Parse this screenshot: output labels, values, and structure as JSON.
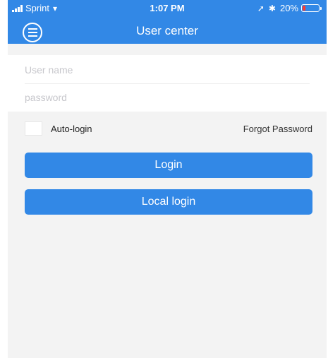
{
  "status_bar": {
    "carrier": "Sprint",
    "time": "1:07 PM",
    "battery": "20%",
    "battery_level": 0.2,
    "icons": [
      "signal-icon",
      "wifi-icon",
      "location-icon",
      "bluetooth-icon",
      "battery-icon"
    ]
  },
  "header": {
    "title": "User center",
    "menu_icon": "menu-icon"
  },
  "form": {
    "username_placeholder": "User name",
    "username_value": "",
    "password_placeholder": "password",
    "password_value": ""
  },
  "options": {
    "auto_login_label": "Auto-login",
    "auto_login_checked": false,
    "forgot_password": "Forgot Password"
  },
  "buttons": {
    "login": "Login",
    "local_login": "Local login"
  },
  "colors": {
    "accent": "#3288e6",
    "background": "#f3f3f3",
    "battery_low": "#ff3b30"
  }
}
